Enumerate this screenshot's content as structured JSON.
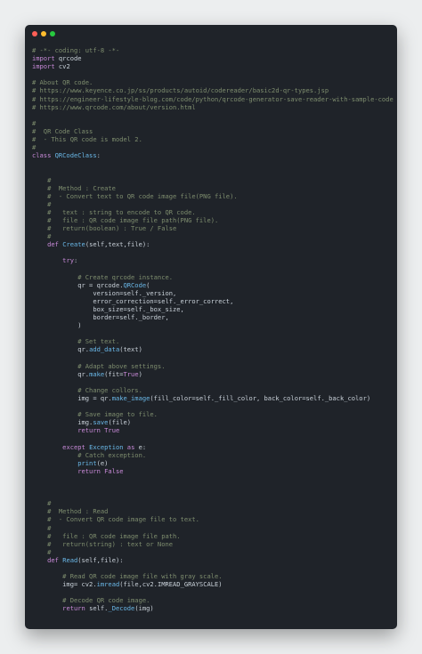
{
  "window": {
    "controls": {
      "close_color": "#ff5f56",
      "minimize_color": "#ffbd2e",
      "maximize_color": "#27c93f"
    }
  },
  "colors": {
    "comment": "#7e8d6e",
    "keyword": "#c88ad8",
    "function": "#6ab8e8",
    "identifier": "#c9d1d9"
  },
  "code": {
    "lines": [
      [
        {
          "t": "# -*- coding: utf-8 -*-",
          "c": "cm"
        }
      ],
      [
        {
          "t": "import ",
          "c": "kw"
        },
        {
          "t": "qrcode",
          "c": "id"
        }
      ],
      [
        {
          "t": "import ",
          "c": "kw"
        },
        {
          "t": "cv2",
          "c": "id"
        }
      ],
      [],
      [
        {
          "t": "# About QR code.",
          "c": "cm"
        }
      ],
      [
        {
          "t": "# https://www.keyence.co.jp/ss/products/autoid/codereader/basic2d-qr-types.jsp",
          "c": "cm"
        }
      ],
      [
        {
          "t": "# https://engineer-lifestyle-blog.com/code/python/qrcode-generator-save-reader-with-sample-code/",
          "c": "cm"
        }
      ],
      [
        {
          "t": "# https://www.qrcode.com/about/version.html",
          "c": "cm"
        }
      ],
      [],
      [
        {
          "t": "#",
          "c": "cm"
        }
      ],
      [
        {
          "t": "#  QR Code Class",
          "c": "cm"
        }
      ],
      [
        {
          "t": "#  - This QR code is model 2.",
          "c": "cm"
        }
      ],
      [
        {
          "t": "#",
          "c": "cm"
        }
      ],
      [
        {
          "t": "class ",
          "c": "kw"
        },
        {
          "t": "QRCodeClass",
          "c": "fn"
        },
        {
          "t": ":",
          "c": "id"
        }
      ],
      [],
      [],
      [
        {
          "t": "    #",
          "c": "cm"
        }
      ],
      [
        {
          "t": "    #  Method : Create",
          "c": "cm"
        }
      ],
      [
        {
          "t": "    #  - Convert text to QR code image file(PNG file).",
          "c": "cm"
        }
      ],
      [
        {
          "t": "    #",
          "c": "cm"
        }
      ],
      [
        {
          "t": "    #   text : string to encode to QR code.",
          "c": "cm"
        }
      ],
      [
        {
          "t": "    #   file : QR code image file path(PNG file).",
          "c": "cm"
        }
      ],
      [
        {
          "t": "    #   return(boolean) : True / False",
          "c": "cm"
        }
      ],
      [
        {
          "t": "    #",
          "c": "cm"
        }
      ],
      [
        {
          "t": "    ",
          "c": "id"
        },
        {
          "t": "def ",
          "c": "kw"
        },
        {
          "t": "Create",
          "c": "fn"
        },
        {
          "t": "(self,text,file):",
          "c": "id"
        }
      ],
      [],
      [
        {
          "t": "        ",
          "c": "id"
        },
        {
          "t": "try",
          "c": "kw"
        },
        {
          "t": ":",
          "c": "id"
        }
      ],
      [],
      [
        {
          "t": "            # Create qrcode instance.",
          "c": "cm"
        }
      ],
      [
        {
          "t": "            qr = qrcode.",
          "c": "id"
        },
        {
          "t": "QRCode",
          "c": "fn"
        },
        {
          "t": "(",
          "c": "id"
        }
      ],
      [
        {
          "t": "                version=self._version,",
          "c": "id"
        }
      ],
      [
        {
          "t": "                error_correction=self._error_correct,",
          "c": "id"
        }
      ],
      [
        {
          "t": "                box_size=self._box_size,",
          "c": "id"
        }
      ],
      [
        {
          "t": "                border=self._border,",
          "c": "id"
        }
      ],
      [
        {
          "t": "            )",
          "c": "id"
        }
      ],
      [],
      [
        {
          "t": "            # Set text.",
          "c": "cm"
        }
      ],
      [
        {
          "t": "            qr.",
          "c": "id"
        },
        {
          "t": "add_data",
          "c": "fn"
        },
        {
          "t": "(text)",
          "c": "id"
        }
      ],
      [],
      [
        {
          "t": "            # Adapt above settings.",
          "c": "cm"
        }
      ],
      [
        {
          "t": "            qr.",
          "c": "id"
        },
        {
          "t": "make",
          "c": "fn"
        },
        {
          "t": "(fit=",
          "c": "id"
        },
        {
          "t": "True",
          "c": "kw"
        },
        {
          "t": ")",
          "c": "id"
        }
      ],
      [],
      [
        {
          "t": "            # Change collors.",
          "c": "cm"
        }
      ],
      [
        {
          "t": "            img = qr.",
          "c": "id"
        },
        {
          "t": "make_image",
          "c": "fn"
        },
        {
          "t": "(fill_color=self._fill_color, back_color=self._back_color)",
          "c": "id"
        }
      ],
      [],
      [
        {
          "t": "            # Save image to file.",
          "c": "cm"
        }
      ],
      [
        {
          "t": "            img.",
          "c": "id"
        },
        {
          "t": "save",
          "c": "fn"
        },
        {
          "t": "(file)",
          "c": "id"
        }
      ],
      [
        {
          "t": "            ",
          "c": "id"
        },
        {
          "t": "return ",
          "c": "kw"
        },
        {
          "t": "True",
          "c": "kw"
        }
      ],
      [],
      [
        {
          "t": "        ",
          "c": "id"
        },
        {
          "t": "except ",
          "c": "kw"
        },
        {
          "t": "Exception ",
          "c": "fn"
        },
        {
          "t": "as ",
          "c": "kw"
        },
        {
          "t": "e:",
          "c": "id"
        }
      ],
      [
        {
          "t": "            # Catch exception.",
          "c": "cm"
        }
      ],
      [
        {
          "t": "            ",
          "c": "id"
        },
        {
          "t": "print",
          "c": "fn"
        },
        {
          "t": "(e)",
          "c": "id"
        }
      ],
      [
        {
          "t": "            ",
          "c": "id"
        },
        {
          "t": "return ",
          "c": "kw"
        },
        {
          "t": "False",
          "c": "kw"
        }
      ],
      [],
      [],
      [],
      [
        {
          "t": "    #",
          "c": "cm"
        }
      ],
      [
        {
          "t": "    #  Method : Read",
          "c": "cm"
        }
      ],
      [
        {
          "t": "    #  - Convert QR code image file to text.",
          "c": "cm"
        }
      ],
      [
        {
          "t": "    #",
          "c": "cm"
        }
      ],
      [
        {
          "t": "    #   file : QR code image file path.",
          "c": "cm"
        }
      ],
      [
        {
          "t": "    #   return(string) : text or None",
          "c": "cm"
        }
      ],
      [
        {
          "t": "    #",
          "c": "cm"
        }
      ],
      [
        {
          "t": "    ",
          "c": "id"
        },
        {
          "t": "def ",
          "c": "kw"
        },
        {
          "t": "Read",
          "c": "fn"
        },
        {
          "t": "(self,file):",
          "c": "id"
        }
      ],
      [],
      [
        {
          "t": "        # Read QR code image file with gray scale.",
          "c": "cm"
        }
      ],
      [
        {
          "t": "        img= cv2.",
          "c": "id"
        },
        {
          "t": "imread",
          "c": "fn"
        },
        {
          "t": "(file,cv2.IMREAD_GRAYSCALE)",
          "c": "id"
        }
      ],
      [],
      [
        {
          "t": "        # Decode QR code image.",
          "c": "cm"
        }
      ],
      [
        {
          "t": "        ",
          "c": "id"
        },
        {
          "t": "return ",
          "c": "kw"
        },
        {
          "t": "self.",
          "c": "id"
        },
        {
          "t": "_Decode",
          "c": "fn"
        },
        {
          "t": "(img)",
          "c": "id"
        }
      ]
    ]
  }
}
